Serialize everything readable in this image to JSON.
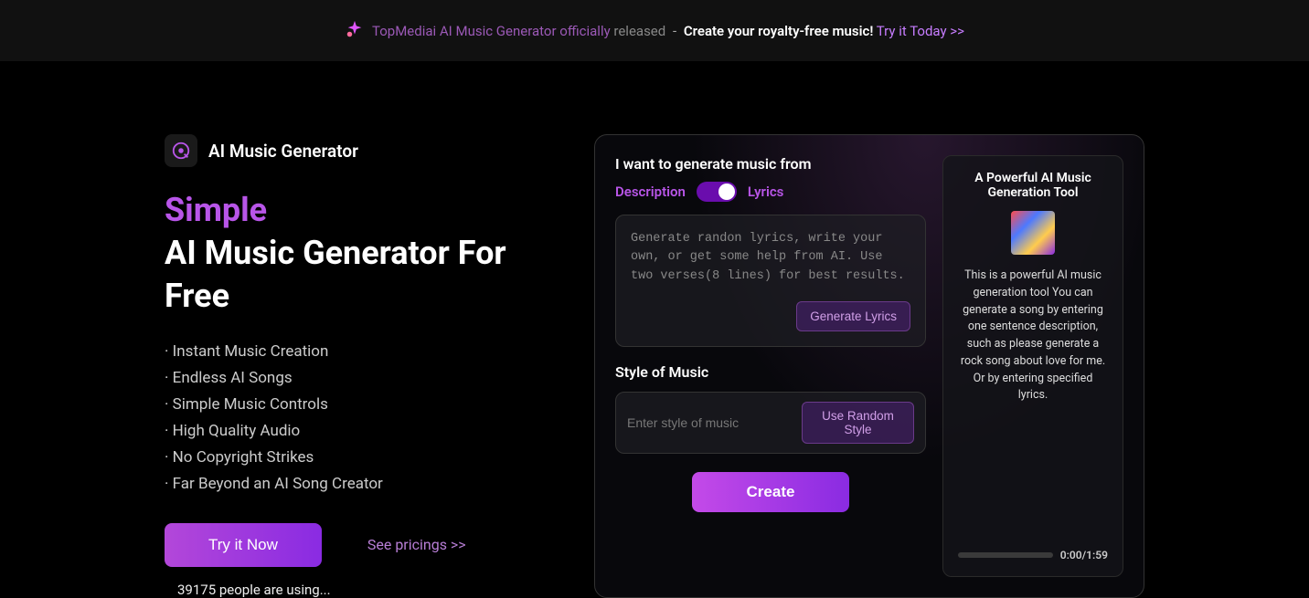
{
  "banner": {
    "link_text": "TopMediai AI Music Generator officially ",
    "released": "released",
    "dash": " - ",
    "create": "Create your royalty-free music!",
    "try": " Try it Today >>"
  },
  "app": {
    "name": "AI Music Generator"
  },
  "hero": {
    "accent": "Simple",
    "rest": "AI Music Generator For Free"
  },
  "features": [
    "· Instant Music Creation",
    "· Endless AI Songs",
    "· Simple Music Controls",
    "· High Quality Audio",
    "· No Copyright Strikes",
    "· Far Beyond an AI Song Creator"
  ],
  "cta": {
    "try_now": "Try it Now",
    "pricing": "See pricings >>",
    "usage": "39175 people are using..."
  },
  "form": {
    "intro": "I want to generate music from",
    "mode_desc": "Description",
    "mode_lyrics": "Lyrics",
    "lyrics_placeholder": "Generate randon lyrics, write your own, or get some help from AI. Use two verses(8 lines) for best results.",
    "gen_lyrics": "Generate Lyrics",
    "style_label": "Style of Music",
    "style_placeholder": "Enter style of music",
    "random_style": "Use Random Style",
    "create": "Create"
  },
  "info": {
    "title": "A Powerful AI Music Generation Tool",
    "desc": "This is a powerful AI music generation tool You can generate a song by entering one sentence description, such as please generate a rock song about love for me. Or by entering specified lyrics.",
    "time": "0:00/1:59"
  }
}
